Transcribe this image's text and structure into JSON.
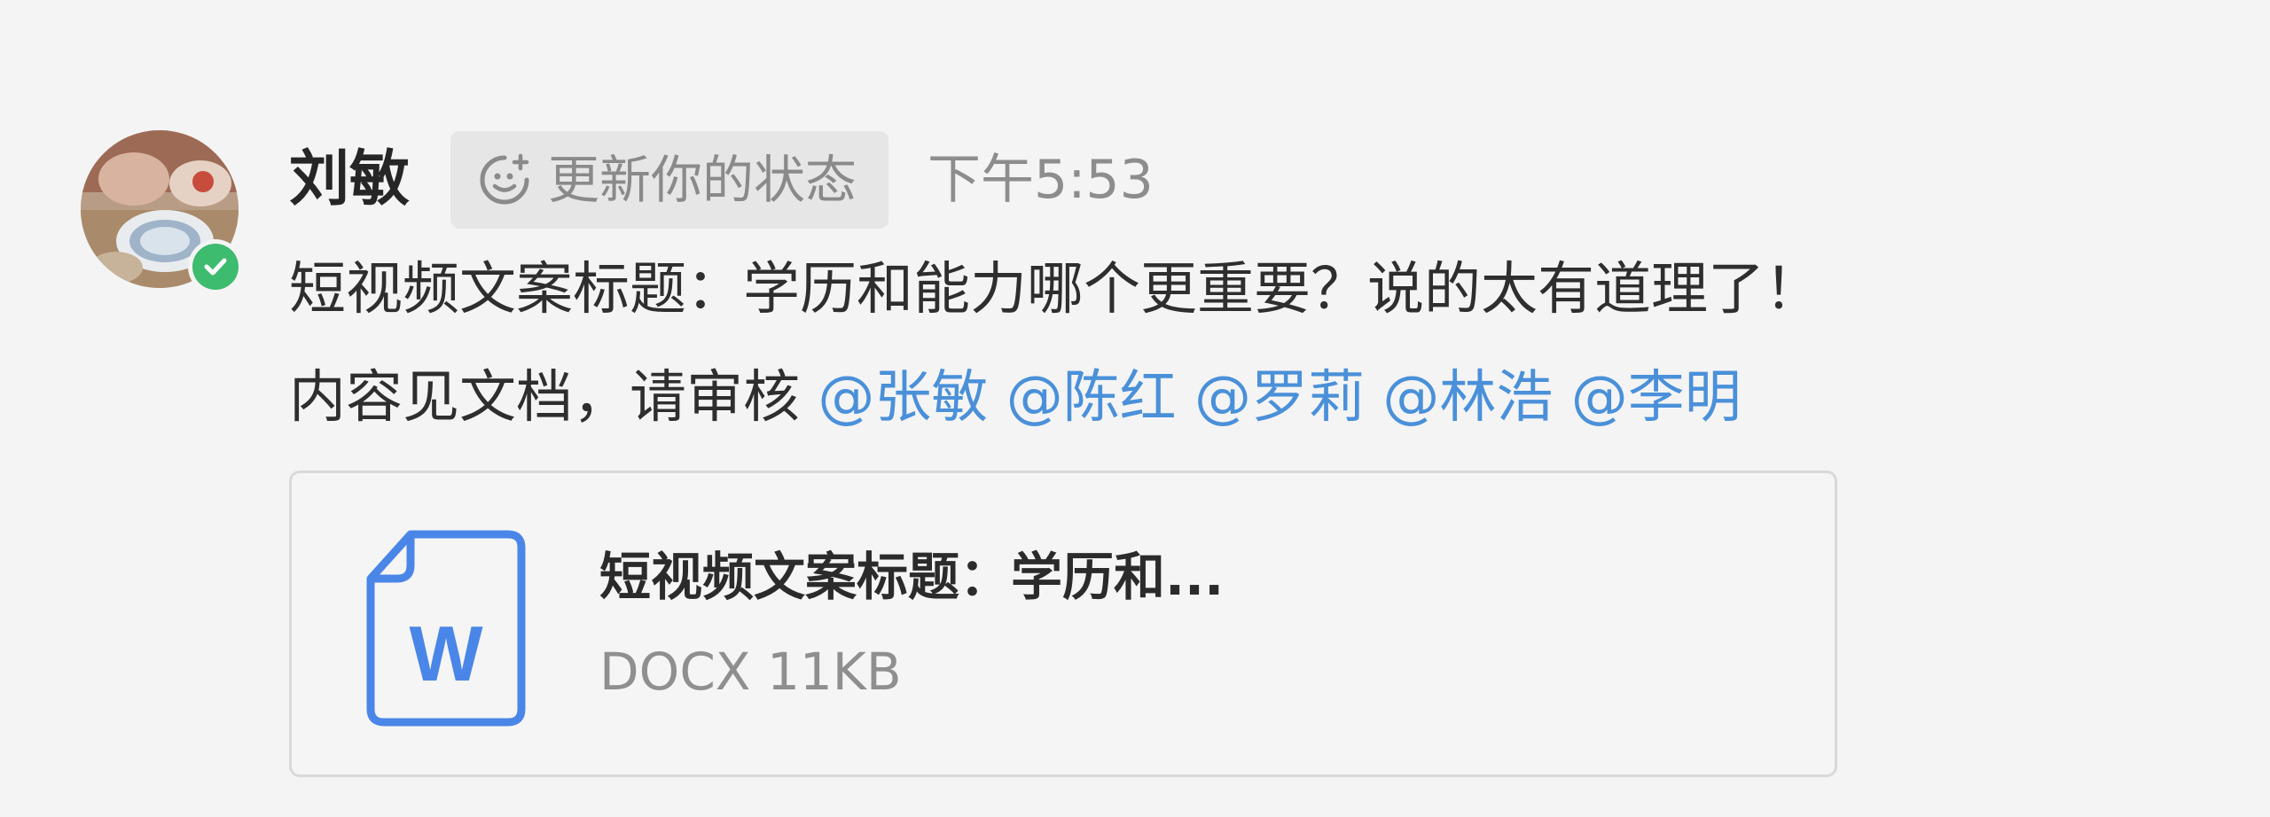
{
  "message": {
    "sender": "刘敏",
    "status_button_label": "更新你的状态",
    "timestamp": "下午5:53",
    "text_line1": "短视频文案标题：学历和能力哪个更重要？说的太有道理了！",
    "text_line2": "内容见文档，请审核",
    "mentions": [
      "@张敏",
      "@陈红",
      "@罗莉",
      "@林浩",
      "@李明"
    ]
  },
  "attachment": {
    "name": "短视频文案标题：学历和...",
    "type": "DOCX",
    "size": "11KB",
    "icon_letter": "W",
    "icon": "word-document-icon"
  },
  "presence": {
    "status": "online",
    "icon": "check-icon"
  },
  "colors": {
    "mention": "#4a90d9",
    "presence": "#3dbb6f",
    "doc_icon": "#4a86e8"
  }
}
